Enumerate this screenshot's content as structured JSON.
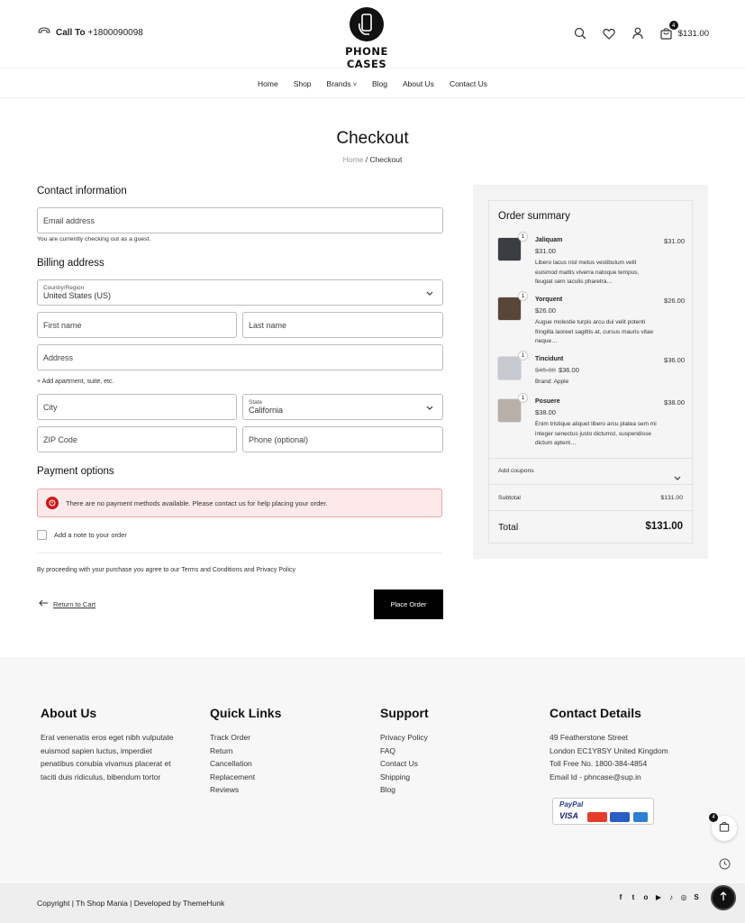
{
  "header": {
    "call_prefix": "Call To",
    "phone": "+1800090098",
    "logo_text": "PHONE CASES",
    "cart_count": "4",
    "cart_total": "$131.00"
  },
  "nav": {
    "items": [
      "Home",
      "Shop",
      "Brands",
      "Blog",
      "About Us",
      "Contact Us"
    ]
  },
  "page": {
    "title": "Checkout",
    "breadcrumb_home": "Home",
    "breadcrumb_sep": "/",
    "breadcrumb_current": "Checkout"
  },
  "contact": {
    "heading": "Contact information",
    "email_placeholder": "Email address",
    "guest_note": "You are currently checking out as a guest."
  },
  "billing": {
    "heading": "Billing address",
    "country_label": "Country/Region",
    "country_value": "United States (US)",
    "first_name": "First name",
    "last_name": "Last name",
    "address": "Address",
    "add_apartment": "+ Add apartment, suite, etc.",
    "city": "City",
    "state_label": "State",
    "state_value": "California",
    "zip": "ZIP Code",
    "phone": "Phone (optional)"
  },
  "payment": {
    "heading": "Payment options",
    "alert": "There are no payment methods available. Please contact us for help placing your order.",
    "note_label": "Add a note to your order",
    "terms": "By proceeding with your purchase you agree to our Terms and Conditions and Privacy Policy",
    "return_label": "Return to Cart",
    "place_order": "Place Order"
  },
  "summary": {
    "heading": "Order summary",
    "items": [
      {
        "name": "Jaliquam",
        "qty": "1",
        "price": "$31.00",
        "old_price": "",
        "total": "$31.00",
        "desc": "Libero lacus nisl metus vestibulum velit euismod mattis viverra natoque tempus, feugiat sem iaculis pharetra…",
        "color": "#3a3d42"
      },
      {
        "name": "Yorquent",
        "qty": "1",
        "price": "$26.00",
        "old_price": "",
        "total": "$26.00",
        "desc": "Augue molestie turpis arcu dui velit potenti fringilla laoreet sagittis at, cursus mauris vitae neque…",
        "color": "#5a4636"
      },
      {
        "name": "Tincidunt",
        "qty": "1",
        "price": "$36.00",
        "old_price": "$45.00",
        "total": "$36.00",
        "desc": "Brand: Apple",
        "color": "#c7c9d1"
      },
      {
        "name": "Posuere",
        "qty": "1",
        "price": "$38.00",
        "old_price": "",
        "total": "$38.00",
        "desc": "Enim tristique aliquet libero arcu platea sem mi integer senectus justo dictumst, suspendisse dictum aptent…",
        "color": "#b8b0a8"
      }
    ],
    "coupons": "Add coupons",
    "subtotal_label": "Subtotal",
    "subtotal_value": "$131.00",
    "total_label": "Total",
    "total_value": "$131.00"
  },
  "footer": {
    "about_heading": "About Us",
    "about_lines": [
      "Erat venenatis eros eget nibh vulputate",
      "euismod sapien luctus, imperdiet",
      "penatibus conubia vivamus placerat et",
      "taciti duis ridiculus, bibendum tortor"
    ],
    "quick_heading": "Quick Links",
    "quick_links": [
      "Track Order",
      "Return",
      "Cancellation",
      "Replacement",
      "Reviews"
    ],
    "support_heading": "Support",
    "support_links": [
      "Privacy Policy",
      "FAQ",
      "Contact Us",
      "Shipping",
      "Blog"
    ],
    "contact_heading": "Contact Details",
    "contact_lines": [
      "49 Featherstone Street",
      "London EC1Y8SY United Kingdom",
      "Toll Free No. 1800-384-4854",
      "Email Id - phncase@sup.in"
    ],
    "paypal": "PayPal",
    "visa": "VISA",
    "copyright": "Copyright | Th Shop Mania | Developed by ThemeHunk",
    "socials": [
      "f",
      "t",
      "o",
      "▶",
      "♪",
      "◎",
      "S"
    ]
  },
  "floating": {
    "cart_count": "4"
  }
}
